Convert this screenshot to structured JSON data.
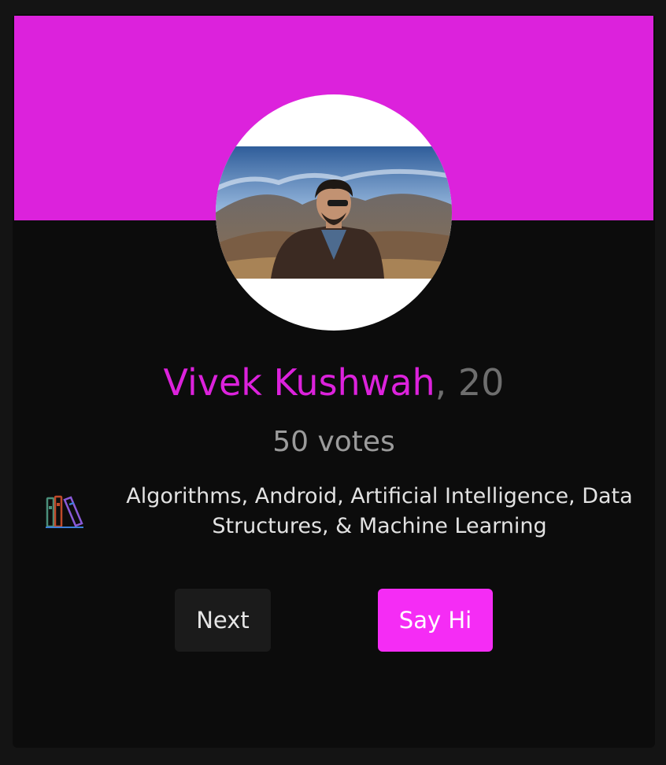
{
  "profile": {
    "name": "Vivek Kushwah",
    "age_text": ", 20",
    "votes_text": "50 votes",
    "interests_text": "Algorithms, Android, Artificial Intelligence, Data Structures, & Machine Learning",
    "avatar_icon": "profile-photo"
  },
  "actions": {
    "next_label": "Next",
    "say_hi_label": "Say Hi"
  },
  "icons": {
    "interests": "books-icon"
  },
  "colors": {
    "accent": "#dc22dc",
    "button_accent": "#f52cf5",
    "card_bg": "#0c0c0c",
    "page_bg": "#141414",
    "muted": "#9b9b9b"
  }
}
